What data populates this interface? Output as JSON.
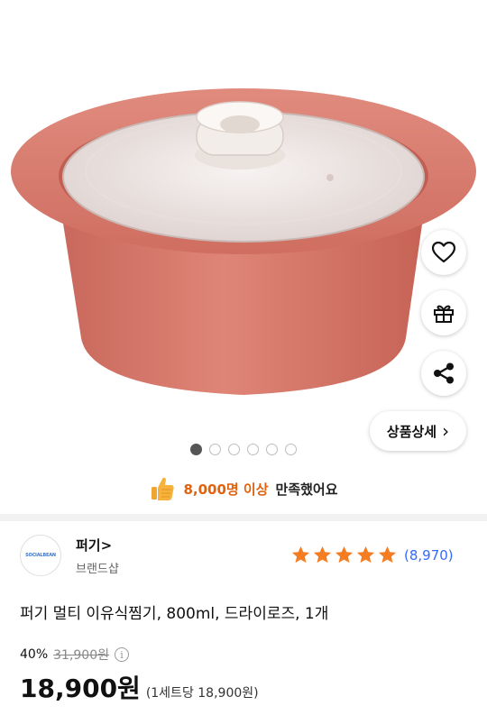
{
  "actions": {
    "wishlist_icon": "heart-icon",
    "gift_icon": "gift-icon",
    "share_icon": "share-icon",
    "detail_label": "상품상세",
    "detail_chevron": "›"
  },
  "gallery": {
    "total_images": 6,
    "active_index": 0
  },
  "satisfaction": {
    "highlight": "8,000명 이상",
    "rest": "만족했어요"
  },
  "brand": {
    "logo_text": "SOCIALBEAN",
    "name": "퍼기",
    "chevron": ">",
    "sub": "브랜드샵"
  },
  "rating": {
    "stars": 5,
    "review_count": "(8,970)"
  },
  "product": {
    "title": "퍼기 멀티 이유식찜기, 800ml, 드라이로즈, 1개",
    "discount_rate": "40%",
    "original_price": "31,900원",
    "info_symbol": "i",
    "price": "18,900원",
    "unit_price": "(1세트당 18,900원)"
  },
  "colors": {
    "accent_orange": "#e0620f",
    "star_orange": "#f57c20",
    "link_blue": "#346aff",
    "pot_color": "#d97b6c"
  }
}
